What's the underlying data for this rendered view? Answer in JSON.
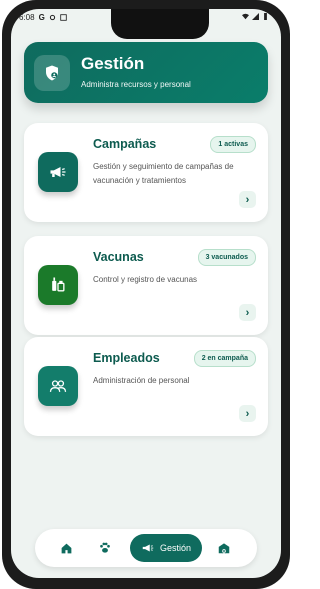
{
  "status_bar": {
    "time": "6:08",
    "icons": [
      "google-icon",
      "gear-icon",
      "a-icon",
      "wifi-icon",
      "signal-icon",
      "battery-icon"
    ]
  },
  "header": {
    "title": "Gestión",
    "subtitle": "Administra recursos y personal",
    "icon": "shield-user-icon"
  },
  "cards": [
    {
      "title": "Campañas",
      "badge": "1 activas",
      "description": "Gestión y seguimiento de campañas de vacunación y tratamientos",
      "icon": "megaphone-icon",
      "color": "#0f6b5e"
    },
    {
      "title": "Vacunas",
      "badge": "3 vacunados",
      "description": "Control y registro de vacunas",
      "icon": "syringe-icon",
      "color": "#1b7a2a"
    },
    {
      "title": "Empleados",
      "badge": "2 en campaña",
      "description": "Administración de personal",
      "icon": "people-icon",
      "color": "#137d6b"
    }
  ],
  "arrow_glyph": "›",
  "bottom_nav": {
    "items": [
      "home-icon",
      "paw-icon",
      "megaphone-icon",
      "barn-icon"
    ],
    "active_label": "Gestión"
  },
  "colors": {
    "primary": "#0f6b5e",
    "badge_bg": "#e6f5ee",
    "screen_bg": "#eef3f1"
  }
}
